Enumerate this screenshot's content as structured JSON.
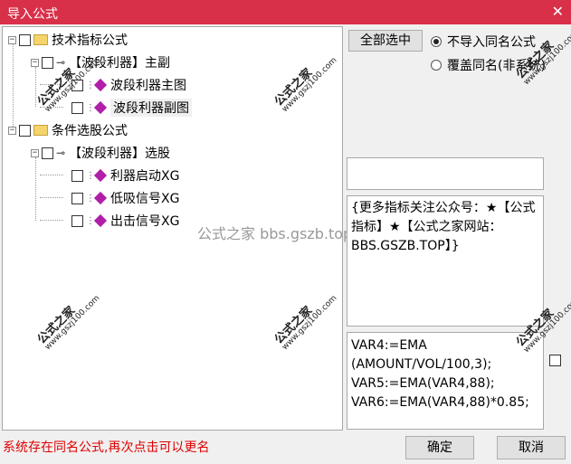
{
  "window": {
    "title": "导入公式",
    "close_glyph": "✕"
  },
  "tree": {
    "group1": {
      "label": "技术指标公式",
      "expander": "−"
    },
    "g1_item": {
      "label": "【波段利器】主副",
      "expander": "−"
    },
    "g1_children": [
      {
        "label": "波段利器主图"
      },
      {
        "label": "波段利器副图"
      }
    ],
    "group2": {
      "label": "条件选股公式",
      "expander": "−"
    },
    "g2_item": {
      "label": "【波段利器】选股",
      "expander": "−"
    },
    "g2_children": [
      {
        "label": "利器启动XG"
      },
      {
        "label": "低吸信号XG"
      },
      {
        "label": "出击信号XG"
      }
    ]
  },
  "controls": {
    "select_all": "全部选中",
    "radio_no_import": "不导入同名公式",
    "radio_overwrite": "覆盖同名(非系统)"
  },
  "description": "{更多指标关注公众号：★【公式指标】★【公式之家网站：BBS.GSZB.TOP】}",
  "code_lines": [
    "VAR4:=EMA",
    "(AMOUNT/VOL/100,3);",
    "VAR5:=EMA(VAR4,88);",
    "VAR6:=EMA(VAR4,88)*0.85;"
  ],
  "status_text": "系统存在同名公式,再次点击可以更名",
  "buttons": {
    "ok": "确定",
    "cancel": "取消"
  },
  "watermark": {
    "big": "公式之家",
    "small": "www.gszj100.com",
    "center": "公式之家 bbs.gszb.top"
  },
  "colors": {
    "titlebar": "#d9304a",
    "status": "#e00000",
    "diamond": "#b01fa8"
  }
}
